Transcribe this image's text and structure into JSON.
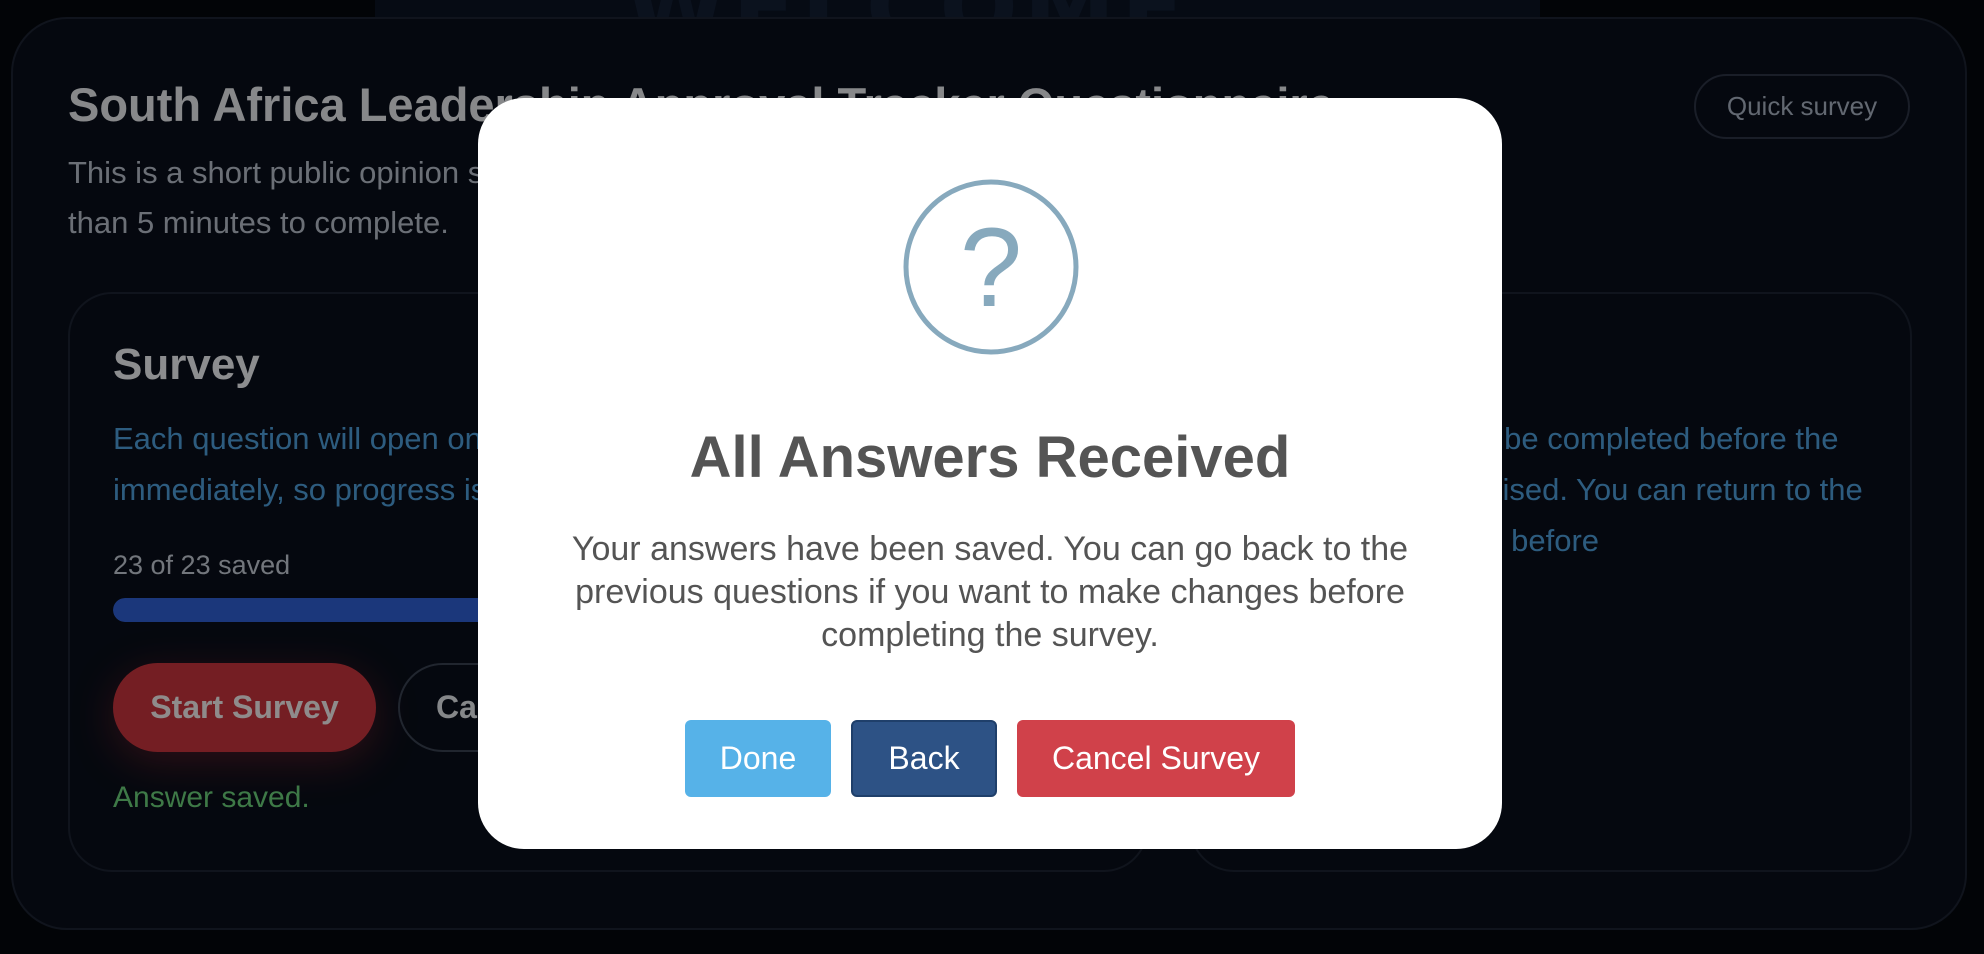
{
  "page": {
    "title": "South Africa Leadership Approval Tracker Questionnaire",
    "quick_survey_label": "Quick survey",
    "intro": "This is a short public opinion survey about leadership approval in South Africa. It will take less than 5 minutes to complete."
  },
  "survey_panel": {
    "heading": "Survey",
    "description": "Each question will open one at a time. Your answers are saved immediately, so progress is kept if you close the survey.",
    "progress_label": "23 of 23 saved",
    "progress": {
      "saved": 23,
      "total": 23
    },
    "start_label": "Start Survey",
    "cancel_label": "Cancel",
    "saved_message": "Answer saved."
  },
  "info_panel": {
    "description": "All questions must be completed before the survey can be finalised. You can return to the previous questions before"
  },
  "modal": {
    "icon": "question-mark-circle-icon",
    "title": "All Answers Received",
    "text": "Your answers have been saved. You can go back to the previous questions if you want to make changes before completing the survey.",
    "buttons": {
      "done": "Done",
      "back": "Back",
      "cancel": "Cancel Survey"
    }
  },
  "colors": {
    "background": "#0a0f1a",
    "accent_blue": "#4f9fdb",
    "progress_fill": "#2f5fd4",
    "danger": "#c9353d",
    "success": "#6bd07a",
    "modal_done": "#56b2e8",
    "modal_back": "#2d5285",
    "modal_cancel": "#d0414a"
  }
}
